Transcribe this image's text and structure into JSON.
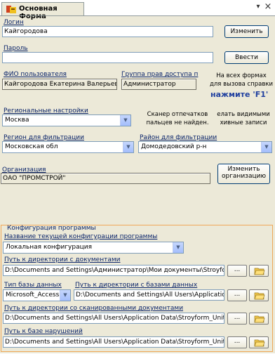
{
  "window": {
    "tab_title": "Основная Форма",
    "pin_glyph": "▾",
    "close_glyph": "×"
  },
  "login": {
    "label": "Логин",
    "value": "Кайгородова",
    "change_button": "Изменить"
  },
  "password": {
    "label": "Пароль",
    "value": "",
    "enter_button": "Ввести"
  },
  "user": {
    "fio_label": "ФИО пользователя",
    "fio_value": "Кайгородова Екатерина Валерьевна",
    "group_label": "Группа  прав доступа п",
    "group_value": "Администратор"
  },
  "help": {
    "line1": "На всех формах",
    "line2": "для вызова справки",
    "key": "нажмите 'F1'"
  },
  "regional": {
    "label": "Региональные настройки",
    "value": "Москва"
  },
  "scanner": {
    "line1": "Сканер отпечатков",
    "line2": "пальцев не найден."
  },
  "hidden_hint": {
    "line1": "елать видимыми",
    "line2": "хивные записи"
  },
  "filter": {
    "region_label": "Регион для фильтрации",
    "region_value": "Московская обл",
    "district_label": "Район для фильтрации",
    "district_value": "Домодедовский р-н"
  },
  "org": {
    "label": "Организация",
    "value": "ОАО \"ПРОМСТРОЙ\"",
    "change_button_line1": "Изменить",
    "change_button_line2": "организацию"
  },
  "config": {
    "group_title": "Конфигурация программы",
    "current_label": "Название текущей конфигурации программы",
    "current_value": "Локальная конфигурация",
    "docs_label": "Путь к директории с документами",
    "docs_value": "D:\\Documents and Settings\\Администратор\\Мои документы\\Stroyform\\",
    "dbtype_label": "Тип базы данных",
    "dbtype_value": "Microsoft_Access",
    "dbdir_label": "Путь к директории с базами данных",
    "dbdir_value": "D:\\Documents and Settings\\All Users\\Application Da",
    "scan_label": "Путь к директории со сканированными документами",
    "scan_value": "D:\\Documents and Settings\\All Users\\Application Data\\Stroyform_UnitInspecti",
    "violations_label": "Путь к базе нарушений",
    "violations_value": "D:\\Documents and Settings\\All Users\\Application Data\\Stroyform_UnitInspecti",
    "browse_label": "..."
  },
  "colors": {
    "accent": "#1f3f9f",
    "group_border": "#f0a858",
    "label_navy": "#0a246a"
  }
}
